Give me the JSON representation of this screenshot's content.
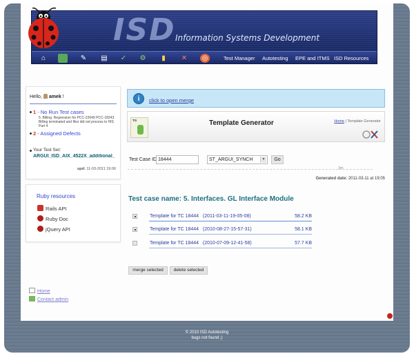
{
  "header": {
    "logo_text": "ISD",
    "subtitle": "Information Systems Development",
    "nav_links": [
      "Test Manager",
      "Autotesting",
      "EPE and ITMS",
      "ISD Resources"
    ]
  },
  "sidebar": {
    "hello_prefix": "Hello,",
    "username": "amek",
    "hello_suffix": "!",
    "no_run_count": "1",
    "no_run_label": "- No Run Test cases",
    "no_run_item": "5. Billing. Regression for PCC-22649 PCC-18243 Billing terminated and files did not process to HIS Part 4",
    "defects_count": "2",
    "defects_label": "- Assigned Defects",
    "testset_label": "Your Test Set:",
    "testset_name": "ARGUI_ISD_AIX_4522X_additional_",
    "upd_label": "upd:",
    "upd_value": "11-03-2011 19:06",
    "ruby_title": "Ruby resources",
    "resources": [
      "Rails API",
      "Ruby Doc",
      "jQuery API"
    ],
    "footer_links": [
      "Home",
      "Contact admin"
    ]
  },
  "merge_bar": {
    "link": "click to open merge"
  },
  "panel": {
    "logo_abbr": "TG",
    "title": "Template Generator",
    "crumb_home": "Home",
    "crumb_sep": "|",
    "crumb_current": "Template Generator"
  },
  "form": {
    "testcase_label": "Test Case ID",
    "testcase_value": "18444",
    "select_value": "ST_ARGUI_SYNCH",
    "go_label": "Go"
  },
  "generated": {
    "label": "Generated date:",
    "value": "2011-03-11 at 19:05"
  },
  "testcase_name": "Test case name: 5. Interfaces. GL Interface Module",
  "templates": [
    {
      "name": "Template for TC 18444",
      "date": "(2011-03-11-19-05-08)",
      "size": "58.2 KB",
      "checked": true
    },
    {
      "name": "Template for TC 18444",
      "date": "(2010-08-27-15-57-31)",
      "size": "58.1 KB",
      "checked": true
    },
    {
      "name": "Template for TC 18444",
      "date": "(2010-07-09-12-41-58)",
      "size": "57.7 KB",
      "checked": false
    }
  ],
  "buttons": {
    "merge": "merge selected",
    "delete": "delete selected"
  },
  "footer": {
    "line1": "© 2010 ISD Autotesting",
    "line2": "bugs not found ;)"
  },
  "colors": {
    "banner": "#1e2f6f",
    "link": "#2d3d9e",
    "accent_red": "#d23c1f",
    "teal": "#1e6f80"
  }
}
